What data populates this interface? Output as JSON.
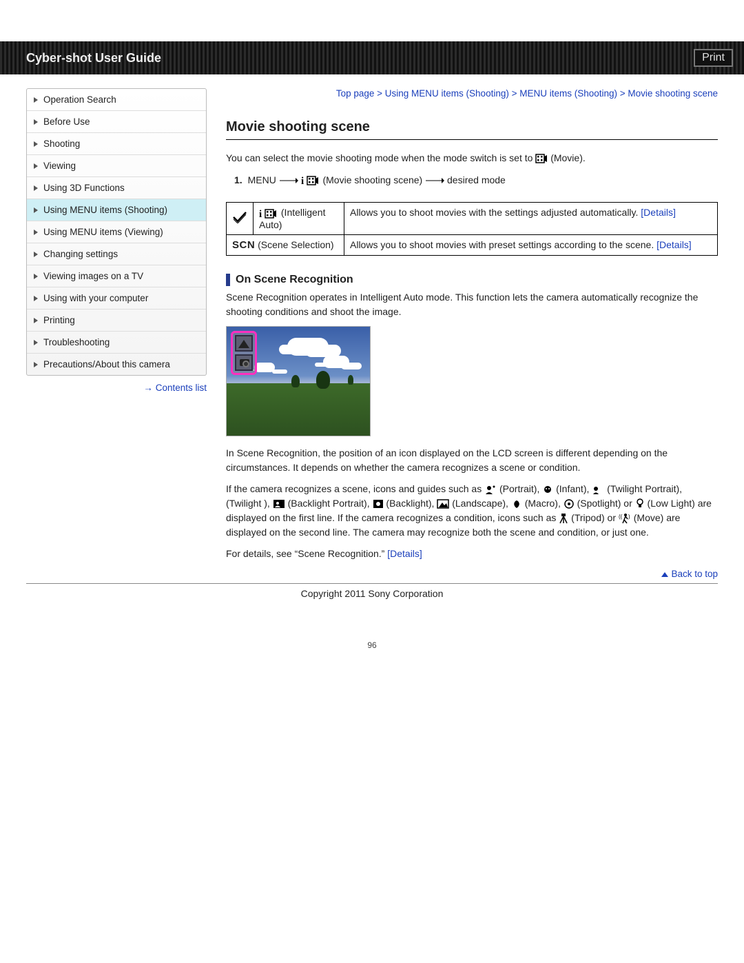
{
  "header": {
    "title": "Cyber-shot User Guide",
    "print": "Print"
  },
  "sidebar": {
    "items": [
      {
        "label": "Operation Search"
      },
      {
        "label": "Before Use"
      },
      {
        "label": "Shooting"
      },
      {
        "label": "Viewing"
      },
      {
        "label": "Using 3D Functions"
      },
      {
        "label": "Using MENU items (Shooting)",
        "active": true
      },
      {
        "label": "Using MENU items (Viewing)"
      },
      {
        "label": "Changing settings"
      },
      {
        "label": "Viewing images on a TV"
      },
      {
        "label": "Using with your computer"
      },
      {
        "label": "Printing"
      },
      {
        "label": "Troubleshooting"
      },
      {
        "label": "Precautions/About this camera"
      }
    ],
    "contents": "Contents list"
  },
  "breadcrumb": {
    "items": [
      "Top page",
      "Using MENU items (Shooting)",
      "MENU items (Shooting)",
      "Movie shooting scene"
    ]
  },
  "main": {
    "title": "Movie shooting scene",
    "intro_a": "You can select the movie shooting mode when the mode switch is set to ",
    "intro_b": "(Movie).",
    "step_num": "1.",
    "step_menu": "MENU",
    "step_mid": "(Movie shooting scene)",
    "step_end": "desired mode",
    "modes": {
      "row1": {
        "name": "(Intelligent Auto)",
        "desc": "Allows you to shoot movies with the settings adjusted automatically.",
        "details": "[Details]"
      },
      "row2": {
        "scn": "SCN",
        "name": "(Scene Selection)",
        "desc": "Allows you to shoot movies with preset settings according to the scene.",
        "details": "[Details]"
      }
    },
    "section2": "On Scene Recognition",
    "sr_intro": "Scene Recognition operates in Intelligent Auto mode. This function lets the camera automatically recognize the shooting conditions and shoot the image.",
    "sr_p1": "In Scene Recognition, the position of an icon displayed on the LCD screen is different depending on the circumstances. It depends on whether the camera recognizes a scene or condition.",
    "sr_icons_lead": "If the camera recognizes a scene, icons and guides such as ",
    "lbl_portrait": "(Portrait), ",
    "lbl_infant": "(Infant), ",
    "lbl_twportrait": "(Twilight Portrait), ",
    "lbl_twilight": "(Twilight ), ",
    "lbl_blportrait": "(Backlight Portrait), ",
    "lbl_backlight": "(Backlight), ",
    "lbl_landscape": "(Landscape), ",
    "lbl_macro": "(Macro), ",
    "lbl_spotlight": "(Spotlight) or ",
    "lbl_lowlight": "(Low Light) are displayed on the first line. If the camera recognizes a condition, icons such as ",
    "lbl_tripod": "(Tripod) or ",
    "lbl_move": "(Move) are displayed on the second line. The camera may recognize both the scene and condition, or just one.",
    "sr_seealso_a": "For details, see “Scene Recognition.” ",
    "sr_seealso_link": "[Details]"
  },
  "footer": {
    "back": "Back to top",
    "copyright": "Copyright 2011 Sony Corporation",
    "page": "96"
  }
}
